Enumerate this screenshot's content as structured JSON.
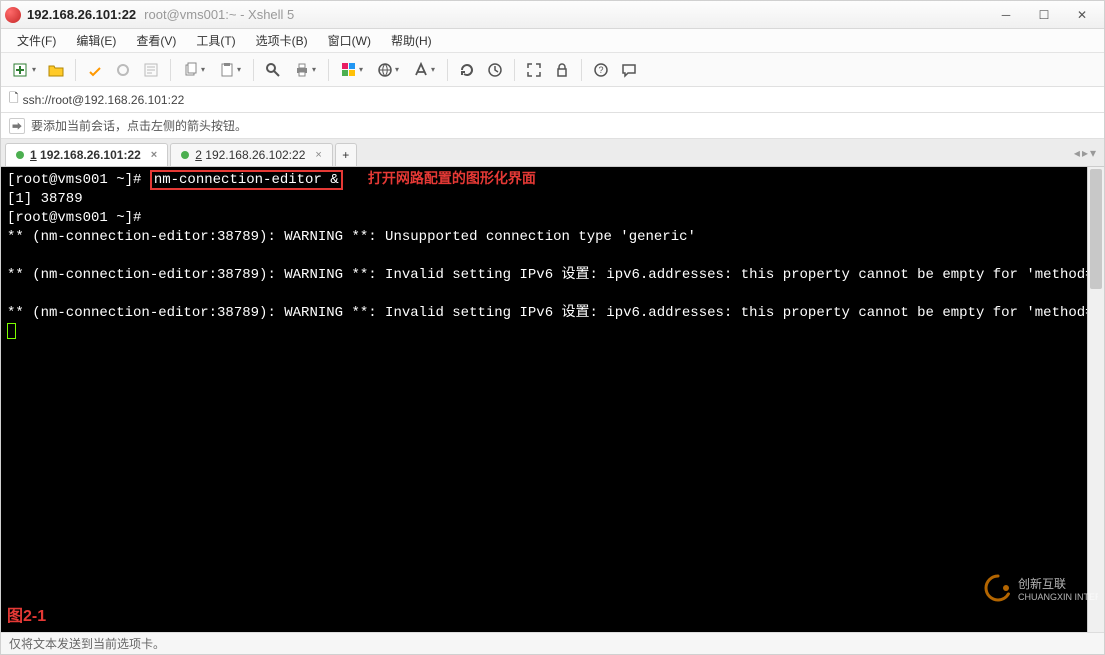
{
  "title": {
    "host": "192.168.26.101:22",
    "sub": "root@vms001:~ - Xshell 5"
  },
  "menu": {
    "file": "文件(F)",
    "edit": "编辑(E)",
    "view": "查看(V)",
    "tools": "工具(T)",
    "tabs": "选项卡(B)",
    "window": "窗口(W)",
    "help": "帮助(H)"
  },
  "address": {
    "url": "ssh://root@192.168.26.101:22"
  },
  "hint": {
    "text": "要添加当前会话，点击左侧的箭头按钮。"
  },
  "tabs": {
    "items": [
      {
        "num": "1",
        "label": "192.168.26.101:22"
      },
      {
        "num": "2",
        "label": "192.168.26.102:22"
      }
    ],
    "add": "+"
  },
  "term": {
    "prompt": "[root@vms001 ~]#",
    "cmd": "nm-connection-editor &",
    "annotation": "打开网路配置的图形化界面",
    "line2": "[1] 38789",
    "line3": "[root@vms001 ~]#",
    "warn1": "** (nm-connection-editor:38789): WARNING **: Unsupported connection type 'generic'",
    "warn2": "** (nm-connection-editor:38789): WARNING **: Invalid setting IPv6 设置: ipv6.addresses: this property cannot be empty for 'method=manual'",
    "warn3": "** (nm-connection-editor:38789): WARNING **: Invalid setting IPv6 设置: ipv6.addresses: this property cannot be empty for 'method=manual'",
    "figlabel": "图2-1"
  },
  "watermark": {
    "brand": "创新互联",
    "sub": "CHUANGXIN INTERNET"
  },
  "status": {
    "text": "仅将文本发送到当前选项卡。"
  },
  "icons": {
    "min": "─",
    "max": "☐",
    "close": "✕",
    "lock": "🔒",
    "arrow": "⮕",
    "plus": "+"
  }
}
